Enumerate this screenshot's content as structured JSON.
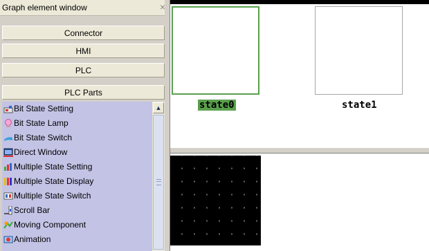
{
  "panel": {
    "title": "Graph element window",
    "close_symbol": "×",
    "categories": [
      {
        "label": "Connector"
      },
      {
        "label": "HMI"
      },
      {
        "label": "PLC"
      },
      {
        "label": "PLC Parts"
      }
    ],
    "items": [
      {
        "label": "Bit State Setting",
        "icon": "bit-state-setting-icon"
      },
      {
        "label": "Bit State Lamp",
        "icon": "lamp-icon"
      },
      {
        "label": "Bit State Switch",
        "icon": "switch-icon"
      },
      {
        "label": "Direct Window",
        "icon": "window-icon"
      },
      {
        "label": "Multiple State Setting",
        "icon": "multi-state-setting-icon"
      },
      {
        "label": "Multiple State Display",
        "icon": "multi-state-display-icon"
      },
      {
        "label": "Multiple State Switch",
        "icon": "multi-state-switch-icon"
      },
      {
        "label": "Scroll Bar",
        "icon": "scroll-bar-icon"
      },
      {
        "label": "Moving Component",
        "icon": "moving-component-icon"
      },
      {
        "label": "Animation",
        "icon": "animation-icon"
      }
    ],
    "scroll_up_symbol": "▲"
  },
  "canvas": {
    "states": [
      {
        "label": "state0",
        "selected": true
      },
      {
        "label": "state1",
        "selected": false
      }
    ]
  },
  "colors": {
    "selection_green": "#5aa04d",
    "list_bg": "#c3c3e6",
    "panel_bg": "#ece9d8"
  }
}
